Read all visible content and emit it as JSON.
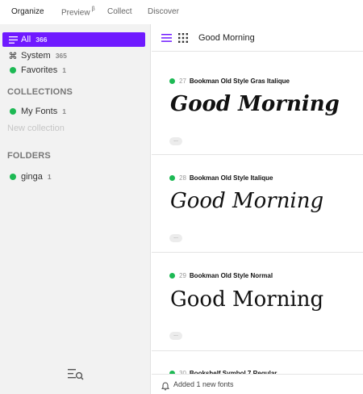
{
  "top_tabs": [
    {
      "label": "Organize",
      "active": true
    },
    {
      "label": "Preview",
      "sup": "β",
      "active": false
    },
    {
      "label": "Collect",
      "active": false
    },
    {
      "label": "Discover",
      "active": false
    }
  ],
  "sidebar": {
    "all": {
      "label": "All",
      "count": "366",
      "icon": "menu-icon"
    },
    "system": {
      "label": "System",
      "count": "365",
      "icon": "command-icon"
    },
    "favorites": {
      "label": "Favorites",
      "count": "1"
    },
    "collections_heading": "COLLECTIONS",
    "my_fonts": {
      "label": "My Fonts",
      "count": "1"
    },
    "new_collection": "New collection",
    "folders_heading": "FOLDERS",
    "ginga": {
      "label": "ginga",
      "count": "1"
    }
  },
  "toolbar": {
    "search_value": "Good Morning"
  },
  "fonts": [
    {
      "index": "27",
      "name": "Bookman Old Style Gras Italique",
      "preview": "Good Morning",
      "more": "..."
    },
    {
      "index": "28",
      "name": "Bookman Old Style Italique",
      "preview": "Good Morning",
      "more": "..."
    },
    {
      "index": "29",
      "name": "Bookman Old Style Normal",
      "preview": "Good Morning",
      "more": "..."
    },
    {
      "index": "30",
      "name": "Bookshelf Symbol 7 Regular"
    }
  ],
  "status": {
    "text": "Added 1 new fonts"
  },
  "colors": {
    "accent": "#6f1aff",
    "active_dot": "#1db954"
  }
}
